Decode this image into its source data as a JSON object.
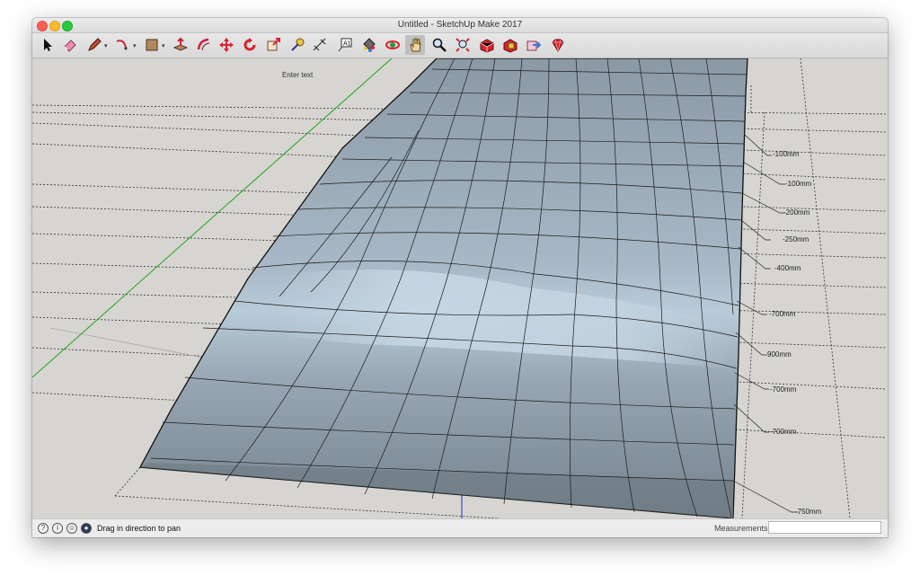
{
  "window": {
    "title": "Untitled - SketchUp Make 2017"
  },
  "toolbar": {
    "tools": [
      {
        "name": "select-tool",
        "icon": "arrow-cursor-icon"
      },
      {
        "name": "eraser-tool",
        "icon": "eraser-icon"
      },
      {
        "name": "pencil-tool",
        "icon": "pencil-icon"
      },
      {
        "name": "arc-tool",
        "icon": "arc-icon"
      },
      {
        "name": "shapes-tool",
        "icon": "rectangle-icon"
      },
      {
        "name": "push-pull-tool",
        "icon": "push-pull-icon"
      },
      {
        "name": "offset-tool",
        "icon": "offset-icon"
      },
      {
        "name": "move-tool",
        "icon": "move-icon"
      },
      {
        "name": "rotate-tool",
        "icon": "rotate-icon"
      },
      {
        "name": "scale-tool",
        "icon": "scale-icon"
      },
      {
        "name": "tape-measure-tool",
        "icon": "tape-measure-icon"
      },
      {
        "name": "dimension-tool",
        "icon": "dimension-icon"
      },
      {
        "name": "text-tool",
        "icon": "text-icon"
      },
      {
        "name": "paint-bucket-tool",
        "icon": "paint-bucket-icon"
      },
      {
        "name": "orbit-tool",
        "icon": "orbit-icon"
      },
      {
        "name": "pan-tool",
        "icon": "hand-icon",
        "active": true
      },
      {
        "name": "zoom-tool",
        "icon": "magnifier-icon"
      },
      {
        "name": "zoom-extents-tool",
        "icon": "zoom-extents-icon"
      },
      {
        "name": "warehouse-tool",
        "icon": "warehouse-icon"
      },
      {
        "name": "extension-warehouse-tool",
        "icon": "extension-warehouse-icon"
      },
      {
        "name": "share-model-tool",
        "icon": "share-icon"
      },
      {
        "name": "ruby-tool",
        "icon": "ruby-icon"
      }
    ]
  },
  "viewport": {
    "text_placeholder": "Enter text",
    "dimensions": [
      {
        "label": "-100mm"
      },
      {
        "label": "-100mm"
      },
      {
        "label": "-200mm"
      },
      {
        "label": "-250mm"
      },
      {
        "label": "-400mm"
      },
      {
        "label": "-700mm"
      },
      {
        "label": "900mm"
      },
      {
        "label": "-700mm"
      },
      {
        "label": "-700mm"
      },
      {
        "label": "-750mm"
      }
    ]
  },
  "statusbar": {
    "icons": [
      "geo-location-icon",
      "credits-icon",
      "user-icon",
      "instructor-icon"
    ],
    "message": "Drag in direction to pan",
    "measurements_label": "Measurements",
    "measurements_value": ""
  },
  "colors": {
    "surface_light": "#b7c8d6",
    "surface_dark": "#727f8a",
    "green_axis": "#1fa51f",
    "blue_axis": "#2531c8"
  }
}
